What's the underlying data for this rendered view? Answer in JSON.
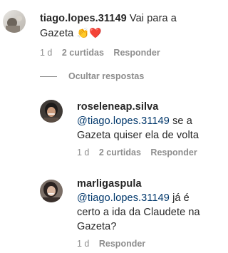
{
  "comments": [
    {
      "username": "tiago.lopes.31149",
      "text_line1": " Vai para a",
      "text_line2": "Gazeta ",
      "emoji": "👏❤️",
      "time": "1 d",
      "likes": "2 curtidas",
      "reply": "Responder"
    }
  ],
  "hide_replies_label": "Ocultar respostas",
  "replies": [
    {
      "username": "roseleneap.silva",
      "mention": "@tiago.lopes.31149",
      "text_after_mention": " se a",
      "text_line2": "Gazeta quiser ela de volta",
      "time": "1 d",
      "likes": "2 curtidas",
      "reply": "Responder"
    },
    {
      "username": "marligaspula",
      "mention": "@tiago.lopes.31149",
      "text_after_mention": " já é",
      "text_line2": "certo a ida da Claudete na",
      "text_line3": "Gazeta?",
      "time": "1 d",
      "reply": "Responder"
    }
  ],
  "colors": {
    "text": "#262626",
    "secondary": "#8e8e8e",
    "mention": "#00376b"
  },
  "icons": [
    "avatar-tiago",
    "avatar-roselene",
    "avatar-marli"
  ]
}
